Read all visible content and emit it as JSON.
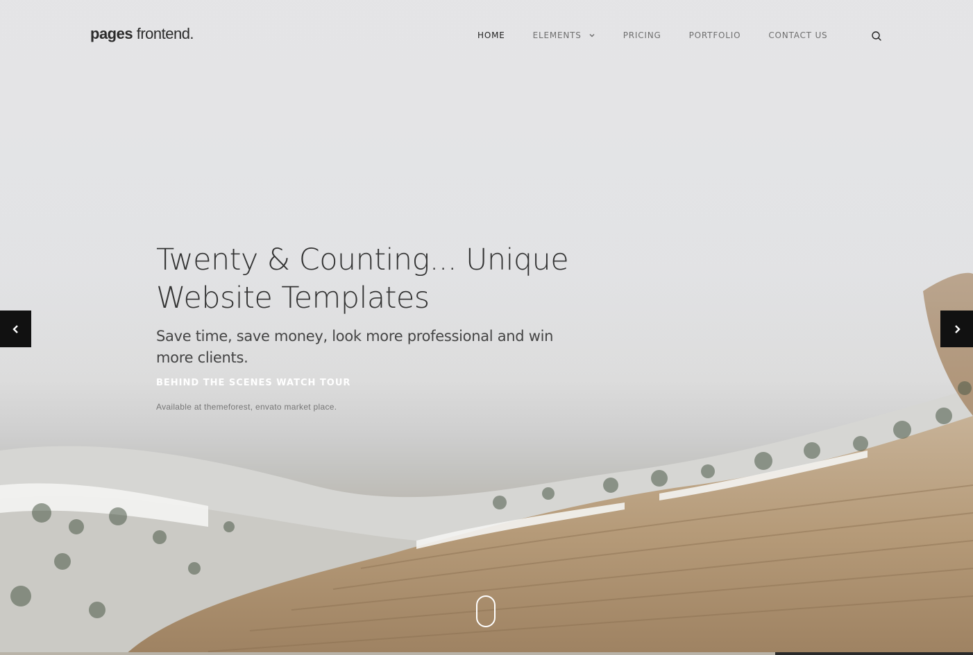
{
  "brand": {
    "logo_bold": "pages",
    "logo_light": " frontend."
  },
  "nav": {
    "items": [
      {
        "label": "HOME",
        "active": true
      },
      {
        "label": "ELEMENTS",
        "has_dropdown": true
      },
      {
        "label": "PRICING"
      },
      {
        "label": "PORTFOLIO"
      },
      {
        "label": "CONTACT US"
      }
    ],
    "search_icon": "search-icon"
  },
  "hero": {
    "title_line1": "Twenty & Counting... Unique",
    "title_line2": "Website Templates",
    "subtitle_line1": "Save time, save money, look more professional and win",
    "subtitle_line2": "more clients.",
    "tour_link": "BEHIND THE SCENES WATCH TOUR",
    "available_note": "Available at themeforest, envato market place."
  },
  "slider": {
    "prev_icon": "chevron-left-icon",
    "next_icon": "chevron-right-icon",
    "scroll_icon": "mouse-scroll-icon"
  },
  "colors": {
    "accent_dark": "#111111",
    "text_dark": "#333333",
    "nav_muted": "#6e6e6e",
    "tour_link": "#ffffff"
  }
}
